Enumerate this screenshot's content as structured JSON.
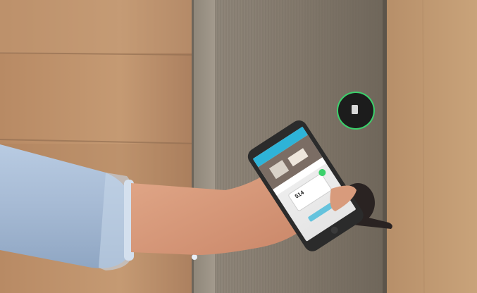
{
  "photo": {
    "description_icons": [
      "hand",
      "smartphone",
      "door-lever",
      "wall-reader"
    ]
  },
  "phone_app": {
    "room_number": "514"
  },
  "colors": {
    "phone_header": "#2eb3d8",
    "reader_ring": "#3bd16b",
    "wood_light": "#b88c68",
    "door_panel": "#7f7568",
    "lever_dark": "#2a2322"
  }
}
